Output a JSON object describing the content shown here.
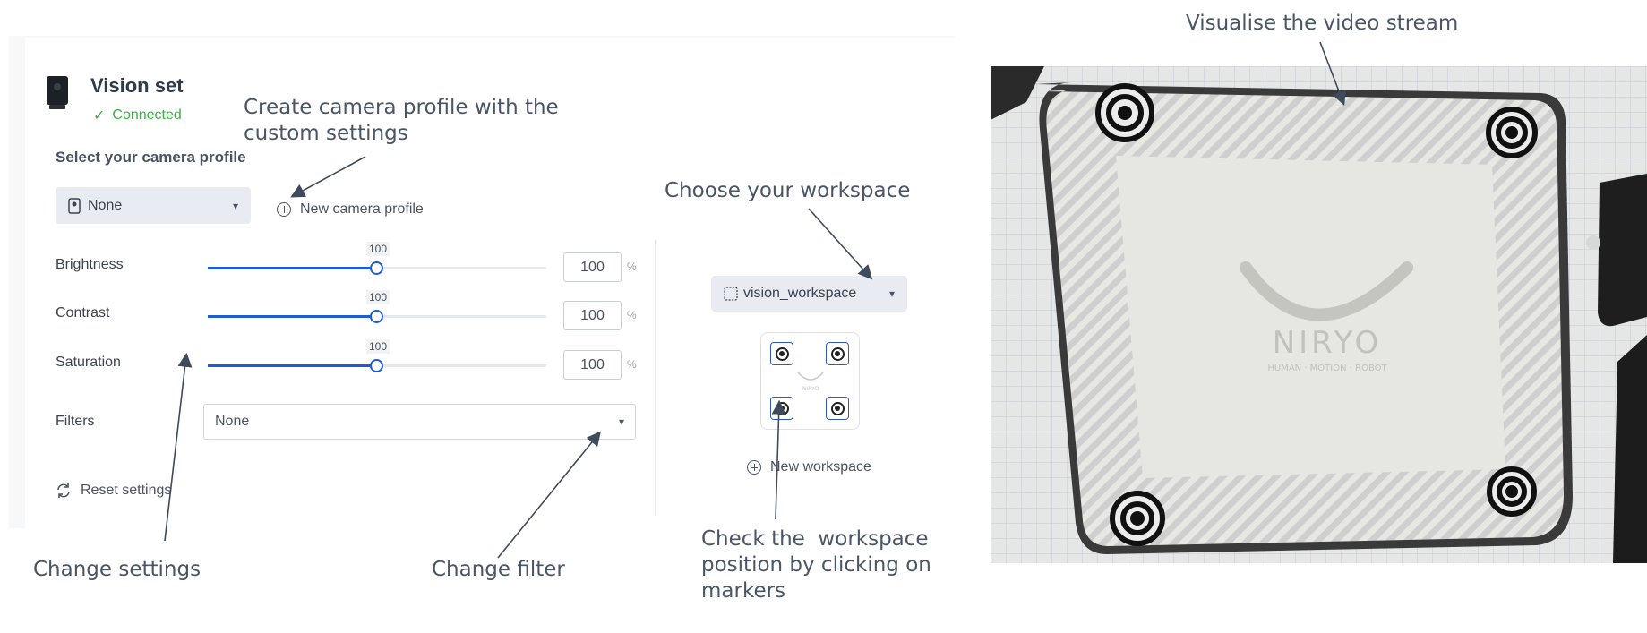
{
  "app": {
    "title": "Vision set",
    "status": "Connected"
  },
  "camera_profile": {
    "label": "Select your camera profile",
    "selected": "None",
    "new_profile_label": "New camera profile"
  },
  "settings": [
    {
      "name": "Brightness",
      "value": "100",
      "unit": "%",
      "level": 0.5
    },
    {
      "name": "Contrast",
      "value": "100",
      "unit": "%",
      "level": 0.5
    },
    {
      "name": "Saturation",
      "value": "100",
      "unit": "%",
      "level": 0.5
    }
  ],
  "filters": {
    "label": "Filters",
    "selected": "None"
  },
  "reset_label": "Reset settings",
  "workspace": {
    "selected": "vision_workspace",
    "preview_logo": "NIRYO",
    "new_workspace_label": "New workspace"
  },
  "video": {
    "logo_text": "NIRYO",
    "tagline": "HUMAN · MOTION · ROBOT"
  },
  "annotations": {
    "create_profile": [
      "Create camera profile with the",
      "custom settings"
    ],
    "choose_workspace": "Choose your workspace",
    "visualise_stream": "Visualise the video stream",
    "change_settings": "Change settings",
    "change_filter": "Change filter",
    "check_workspace": [
      "Check the  workspace",
      "position by clicking on",
      "markers"
    ]
  },
  "colors": {
    "accent": "#1e5bd6",
    "connected": "#3fae49",
    "annotation_text": "#4a5566"
  }
}
